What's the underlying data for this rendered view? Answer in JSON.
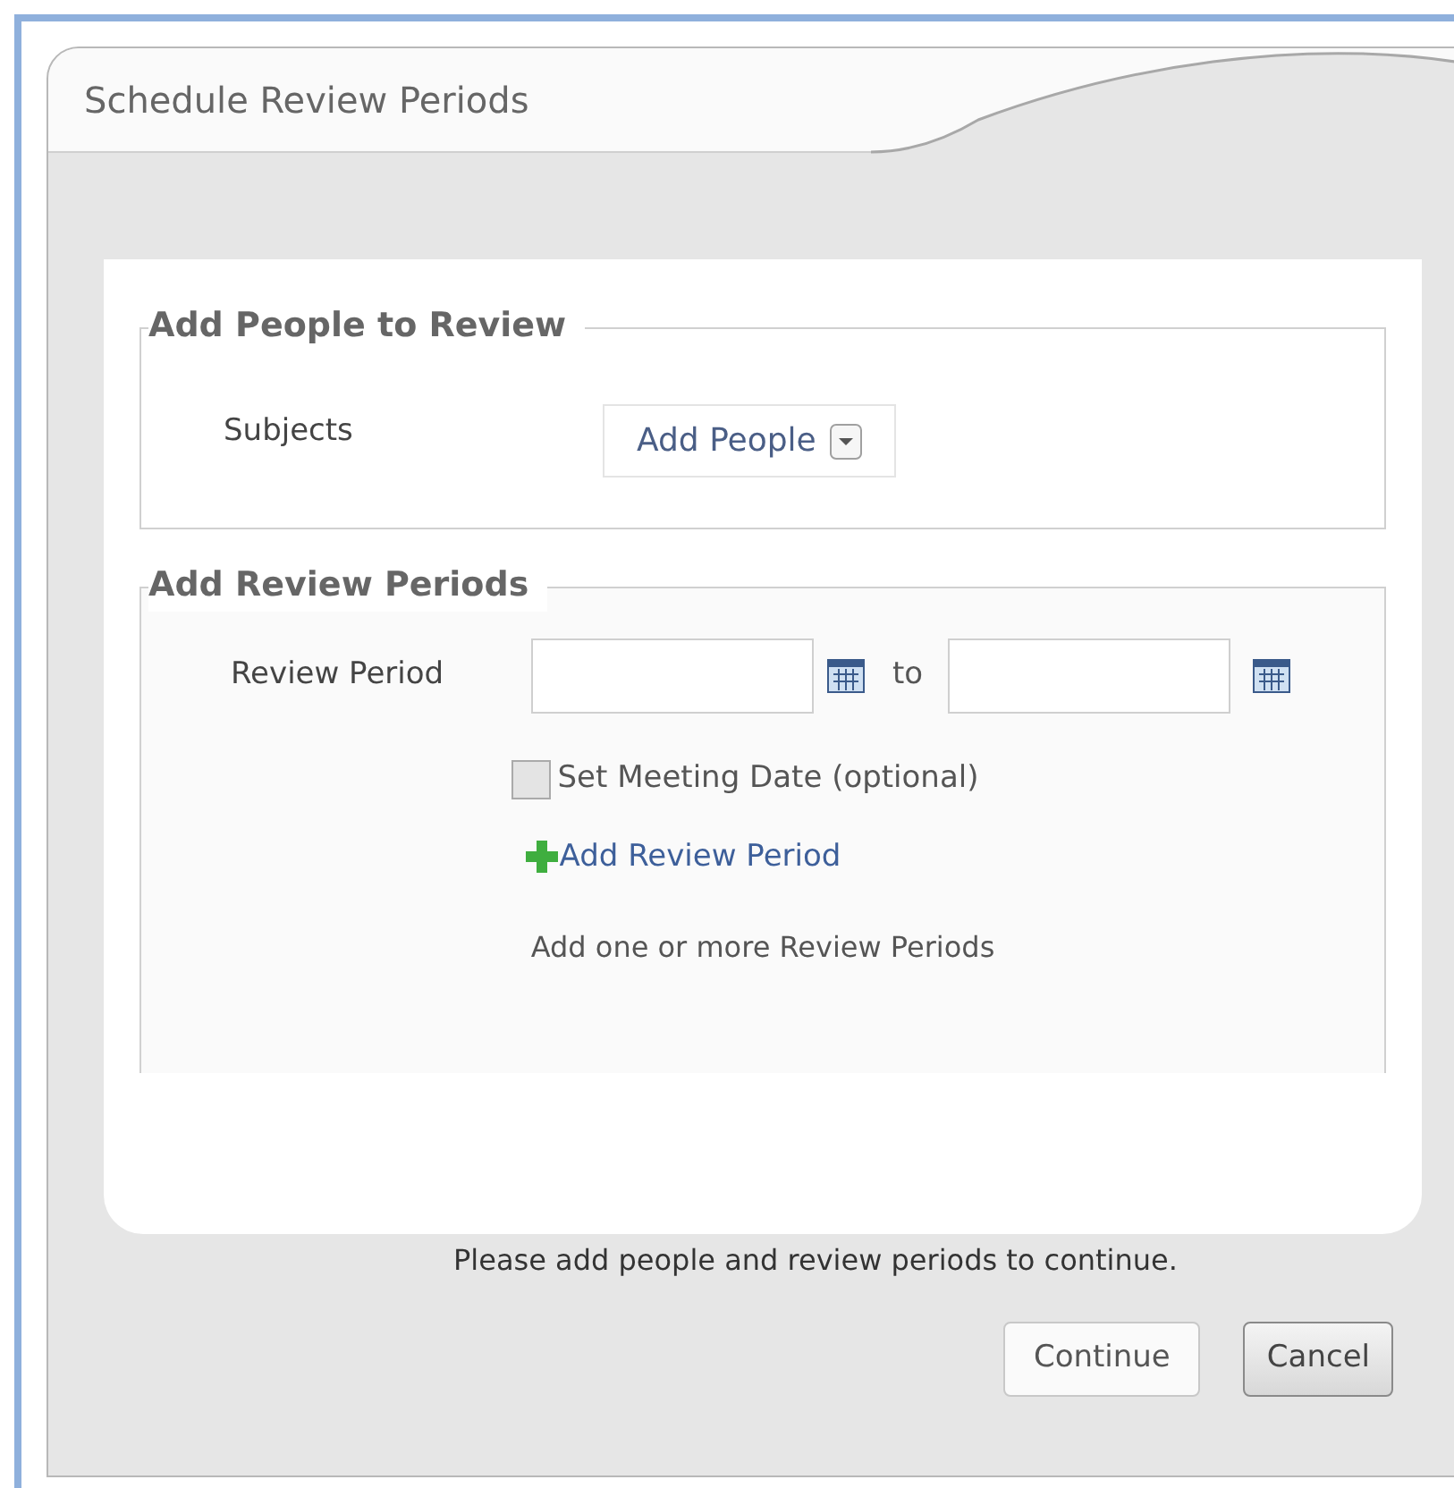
{
  "dialog": {
    "title": "Schedule Review Periods"
  },
  "people_section": {
    "legend": "Add People to Review",
    "label": "Subjects",
    "dropdown": "Add People"
  },
  "periods_section": {
    "legend": "Add Review Periods",
    "label": "Review Period",
    "separator": "to",
    "meeting_checkbox": {
      "label": "Set Meeting Date (optional)",
      "checked": false
    },
    "add_link": "Add Review Period",
    "hint": "Add one or more Review Periods"
  },
  "message": "Please add people and review periods to continue.",
  "buttons": [
    {
      "label": "Continue",
      "kind": "primary"
    },
    {
      "label": "Cancel",
      "kind": "secondary"
    }
  ]
}
